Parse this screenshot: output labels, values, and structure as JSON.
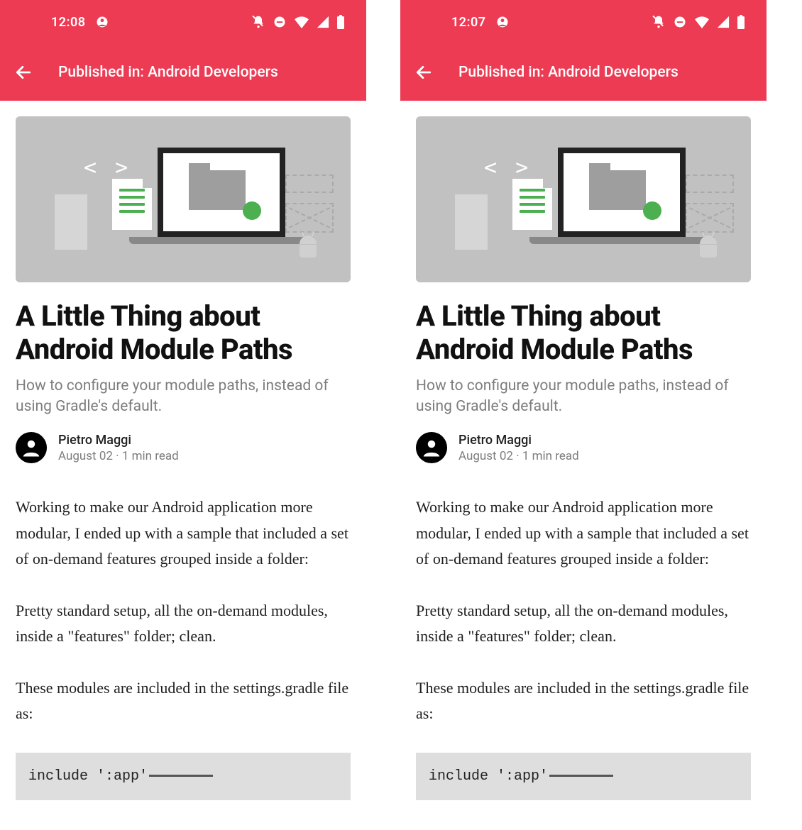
{
  "screens": [
    {
      "time": "12:08"
    },
    {
      "time": "12:07"
    }
  ],
  "appbar": {
    "title": "Published in: Android Developers"
  },
  "article": {
    "title": "A Little Thing about Android Module Paths",
    "subtitle": "How to configure your module paths, instead of using Gradle's default.",
    "author": "Pietro Maggi",
    "date": "August 02",
    "read_time": "1 min read",
    "separator": " · ",
    "paragraphs": [
      "Working to make our Android application more modular, I ended up with a sample that included a set of on-demand features grouped inside a folder:",
      "Pretty standard setup, all the on-demand modules, inside a \"features\" folder; clean.",
      "These modules are included in the settings.gradle file as:"
    ],
    "code_line": "include ':app'"
  },
  "icons": {
    "back": "arrow-left",
    "profile": "circle-profile",
    "dnd": "do-not-disturb",
    "mute": "bell-off",
    "wifi": "wifi",
    "signal": "cellular",
    "battery": "battery-full"
  }
}
